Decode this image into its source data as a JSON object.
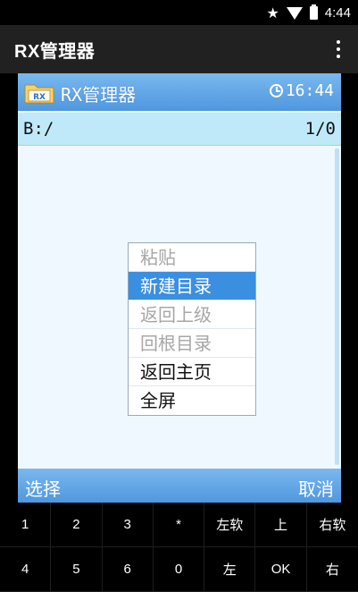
{
  "status_bar": {
    "time": "4:44",
    "icons": [
      "star-icon",
      "wifi-icon",
      "battery-icon"
    ]
  },
  "app_bar": {
    "title": "RX管理器",
    "menu_icon": "overflow-menu-icon"
  },
  "device": {
    "title": "RX管理器",
    "clock": "16:44",
    "path": "B:/",
    "count": "1/0",
    "softkey_left": "选择",
    "softkey_right": "取消"
  },
  "context_menu": {
    "items": [
      {
        "label": "粘贴",
        "state": "disabled"
      },
      {
        "label": "新建目录",
        "state": "selected"
      },
      {
        "label": "返回上级",
        "state": "disabled"
      },
      {
        "label": "回根目录",
        "state": "disabled"
      },
      {
        "label": "返回主页",
        "state": "enabled"
      },
      {
        "label": "全屏",
        "state": "enabled"
      }
    ]
  },
  "keypad": {
    "keys": [
      "1",
      "2",
      "3",
      "*",
      "左软",
      "上",
      "右软",
      "4",
      "5",
      "6",
      "0",
      "左",
      "OK",
      "右"
    ]
  },
  "colors": {
    "title_bar": "#5a9fe3",
    "path_bar": "#bfe9f9",
    "selected": "#3b8fe0",
    "app_bar": "#212121"
  }
}
